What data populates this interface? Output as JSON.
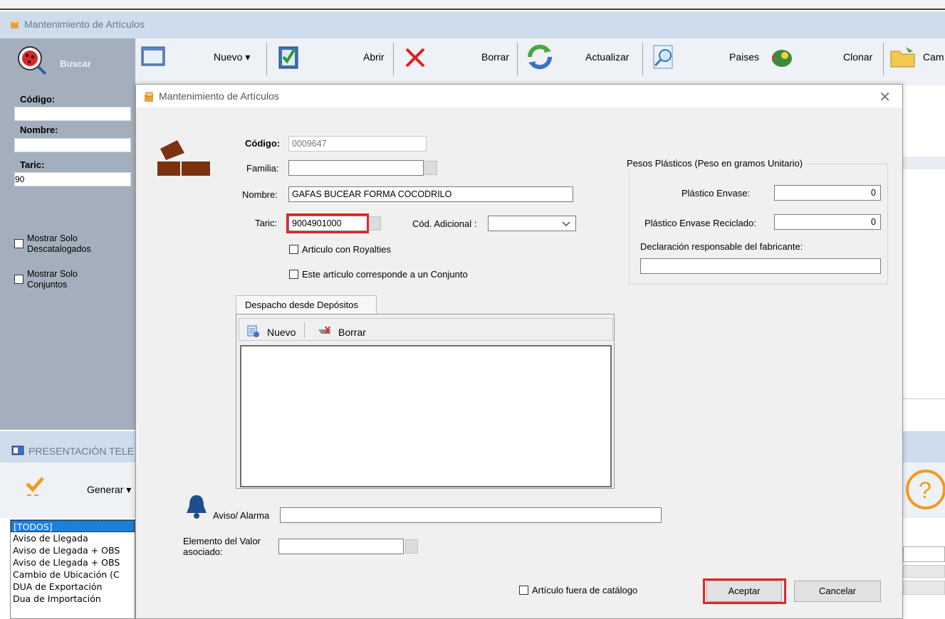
{
  "background_window": {
    "title": "Mantenimiento de Artículos",
    "search_label": "Buscar",
    "toolbar": [
      {
        "id": "nuevo",
        "label": "Nuevo ▾"
      },
      {
        "id": "abrir",
        "label": "Abrir"
      },
      {
        "id": "borrar",
        "label": "Borrar"
      },
      {
        "id": "actualizar",
        "label": "Actualizar"
      },
      {
        "id": "paises",
        "label": "Paises"
      },
      {
        "id": "clonar",
        "label": "Clonar"
      },
      {
        "id": "cam",
        "label": "Cam"
      }
    ],
    "filters": {
      "codigo_label": "Código:",
      "codigo_value": "",
      "nombre_label": "Nombre:",
      "nombre_value": "",
      "taric_label": "Taric:",
      "taric_value": "90",
      "solo_descatalogados": "Mostrar Solo Descatalogados",
      "solo_conjuntos": "Mostrar Solo Conjuntos"
    }
  },
  "bottom_window": {
    "title": "PRESENTACIÓN TELE",
    "generar_label": "Generar ▾",
    "list_items": [
      "[TODOS]",
      "Aviso de Llegada",
      "Aviso de Llegada + OBS",
      "Aviso de Llegada + OBS",
      "Cambio de Ubicación (C",
      "DUA de Exportación",
      "Dua de Importación"
    ]
  },
  "dialog": {
    "title": "Mantenimiento de Artículos",
    "close_glyph": "✕",
    "codigo_label": "Código:",
    "codigo_value": "0009647",
    "familia_label": "Familia:",
    "familia_value": "",
    "nombre_label": "Nombre:",
    "nombre_value": "GAFAS BUCEAR FORMA COCODRILO",
    "taric_label": "Taric:",
    "taric_value": "9004901000",
    "cod_adicional_label": "Cód. Adicional :",
    "cod_adicional_value": "",
    "royalties_label": "Articulo con Royalties",
    "conjunto_label": "Este artículo corresponde a un Conjunto",
    "pesos_group_title": "Pesos Plásticos (Peso en gramos Unitario)",
    "plastico_envase_label": "Plástico Envase:",
    "plastico_envase_value": "0",
    "plastico_reciclado_label": "Plástico Envase Reciclado:",
    "plastico_reciclado_value": "0",
    "declaracion_label": "Declaración responsable del fabricante:",
    "declaracion_value": "",
    "tab_label": "Despacho desde Depósitos",
    "sub_nuevo": "Nuevo",
    "sub_borrar": "Borrar",
    "aviso_label": "Aviso/ Alarma",
    "aviso_value": "",
    "elemento_label": "Elemento del Valor asociado:",
    "elemento_value": "",
    "fuera_catalogo_label": "Artículo fuera de catálogo",
    "aceptar_label": "Aceptar",
    "cancelar_label": "Cancelar"
  },
  "colors": {
    "highlight_red": "#e0262b",
    "selection_blue": "#1e7fd9"
  }
}
